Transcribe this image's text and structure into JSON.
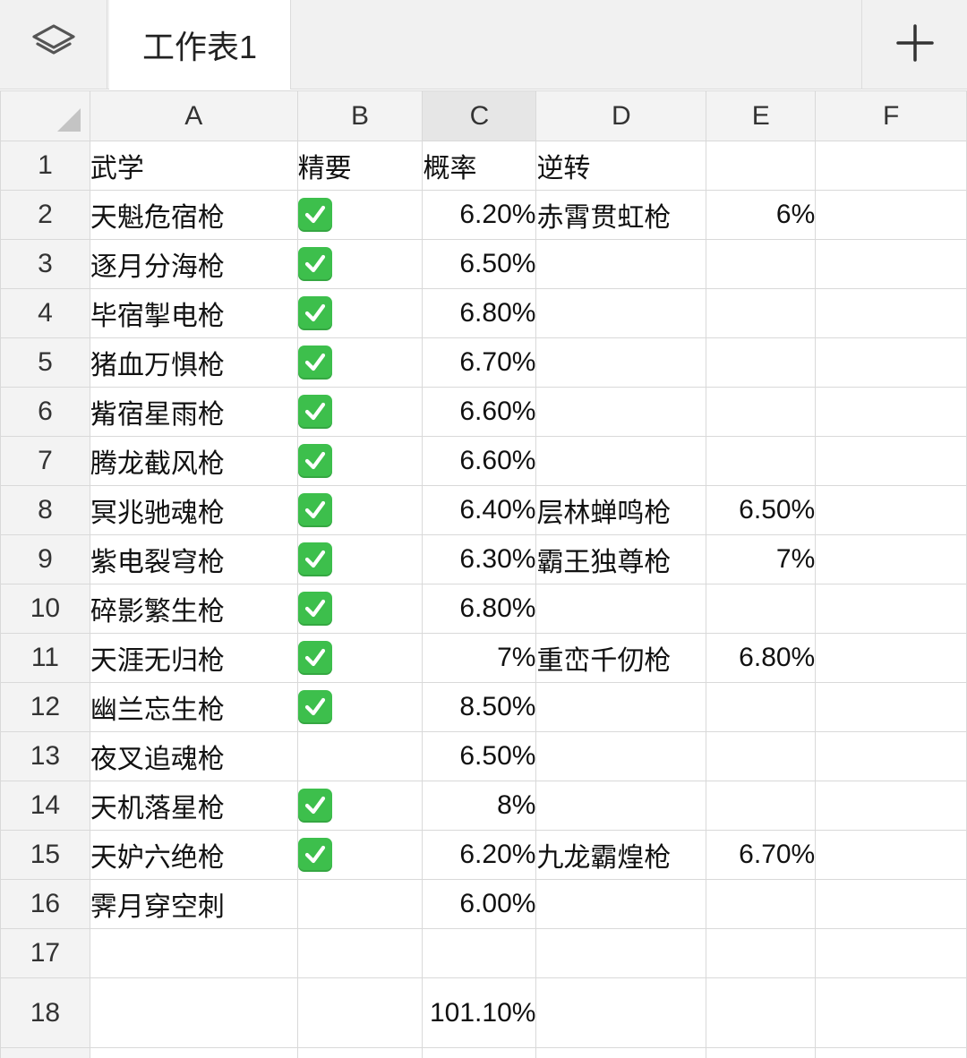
{
  "tabbar": {
    "layers_icon": "layers-icon",
    "sheet_name": "工作表1",
    "add_icon": "plus-icon"
  },
  "columns": [
    "A",
    "B",
    "C",
    "D",
    "E",
    "F"
  ],
  "rows": [
    {
      "n": "1",
      "A": "武学",
      "B": "精要",
      "C": "概率",
      "D": "逆转",
      "E": "",
      "check": false,
      "b_text": true
    },
    {
      "n": "2",
      "A": "天魁危宿枪",
      "check": true,
      "C": "6.20%",
      "D": "赤霄贯虹枪",
      "E": "6%"
    },
    {
      "n": "3",
      "A": "逐月分海枪",
      "check": true,
      "C": "6.50%",
      "D": "",
      "E": ""
    },
    {
      "n": "4",
      "A": "毕宿掣电枪",
      "check": true,
      "C": "6.80%",
      "D": "",
      "E": ""
    },
    {
      "n": "5",
      "A": "猪血万惧枪",
      "check": true,
      "C": "6.70%",
      "D": "",
      "E": ""
    },
    {
      "n": "6",
      "A": "觜宿星雨枪",
      "check": true,
      "C": "6.60%",
      "D": "",
      "E": ""
    },
    {
      "n": "7",
      "A": "腾龙截风枪",
      "check": true,
      "C": "6.60%",
      "D": "",
      "E": ""
    },
    {
      "n": "8",
      "A": "冥兆驰魂枪",
      "check": true,
      "C": "6.40%",
      "D": "层林蝉鸣枪",
      "E": "6.50%"
    },
    {
      "n": "9",
      "A": "紫电裂穹枪",
      "check": true,
      "C": "6.30%",
      "D": "霸王独尊枪",
      "E": "7%"
    },
    {
      "n": "10",
      "A": "碎影繁生枪",
      "check": true,
      "C": "6.80%",
      "D": "",
      "E": ""
    },
    {
      "n": "11",
      "A": "天涯无归枪",
      "check": true,
      "C": "7%",
      "D": "重峦千仞枪",
      "E": "6.80%"
    },
    {
      "n": "12",
      "A": "幽兰忘生枪",
      "check": true,
      "C": "8.50%",
      "D": "",
      "E": ""
    },
    {
      "n": "13",
      "A": "夜叉追魂枪",
      "check": false,
      "C": "6.50%",
      "D": "",
      "E": ""
    },
    {
      "n": "14",
      "A": "天机落星枪",
      "check": true,
      "C": "8%",
      "D": "",
      "E": ""
    },
    {
      "n": "15",
      "A": "天妒六绝枪",
      "check": true,
      "C": "6.20%",
      "D": "九龙霸煌枪",
      "E": "6.70%"
    },
    {
      "n": "16",
      "A": "霁月穿空刺",
      "check": false,
      "C": "6.00%",
      "D": "",
      "E": ""
    },
    {
      "n": "17",
      "A": "",
      "check": false,
      "C": "",
      "D": "",
      "E": ""
    },
    {
      "n": "18",
      "A": "",
      "check": false,
      "C": "101.10%",
      "D": "",
      "E": ""
    }
  ],
  "colors": {
    "check_green": "#3dbf4c",
    "header_bg": "#f3f3f3",
    "grid_line": "#d9d9d9"
  }
}
